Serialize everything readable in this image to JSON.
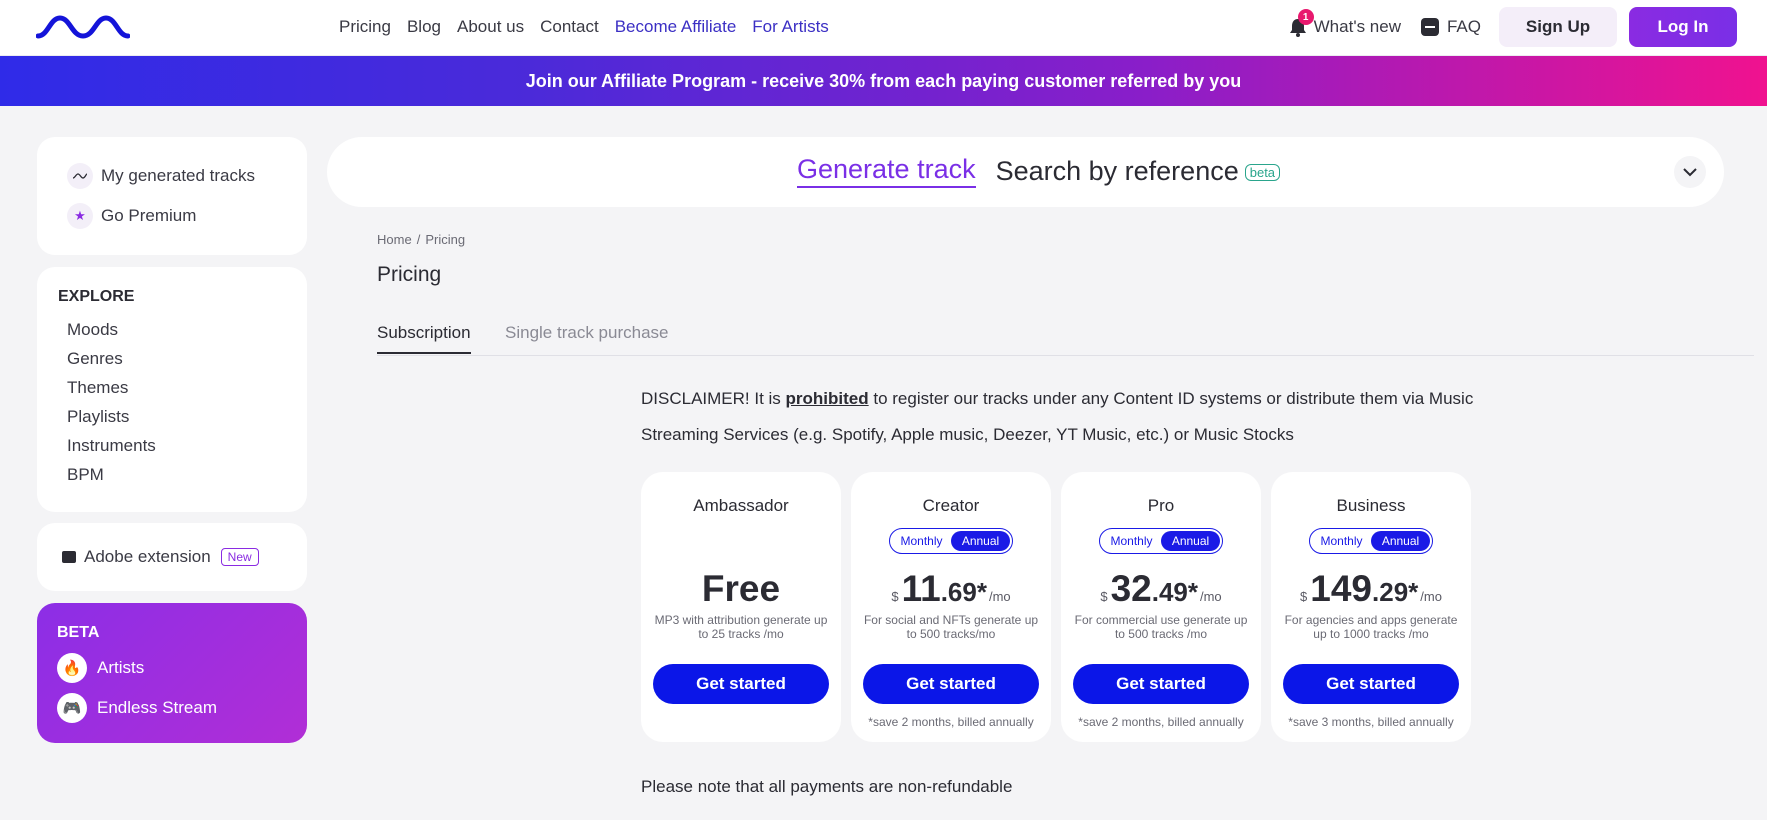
{
  "header": {
    "nav": [
      "Pricing",
      "Blog",
      "About us",
      "Contact",
      "Become Affiliate",
      "For Artists"
    ],
    "whats_new": "What's new",
    "notification_count": "1",
    "faq": "FAQ",
    "sign_up": "Sign Up",
    "log_in": "Log In"
  },
  "banner": "Join our Affiliate Program - receive 30% from each paying customer referred by you",
  "sidebar": {
    "top_items": [
      "My generated tracks",
      "Go Premium"
    ],
    "explore_title": "EXPLORE",
    "explore_items": [
      "Moods",
      "Genres",
      "Themes",
      "Playlists",
      "Instruments",
      "BPM"
    ],
    "adobe": "Adobe extension",
    "adobe_badge": "New",
    "beta_title": "BETA",
    "beta_items": [
      "Artists",
      "Endless Stream"
    ]
  },
  "generator": {
    "active_tab": "Generate track",
    "other_tab": "Search by reference",
    "beta_badge": "beta"
  },
  "breadcrumb": [
    "Home",
    "Pricing"
  ],
  "breadcrumb_sep": "/",
  "page_title": "Pricing",
  "tabs": [
    "Subscription",
    "Single track purchase"
  ],
  "disclaimer": {
    "lead": "DISCLAIMER! It is ",
    "emphasis": "prohibited",
    "rest": " to register our tracks under any Content ID systems or distribute them via Music Streaming Services (e.g. Spotify, Apple music, Deezer, YT Music, etc.) or Music Stocks"
  },
  "plans": [
    {
      "name": "Ambassador",
      "price": "Free",
      "desc": "MP3 with attribution generate up to 25 tracks /mo",
      "cta": "Get started"
    },
    {
      "name": "Creator",
      "toggle": [
        "Monthly",
        "Annual"
      ],
      "currency": "$",
      "int": "11",
      "dec": ".69*",
      "per": "/mo",
      "desc": "For social and NFTs generate up to 500 tracks/mo",
      "cta": "Get started",
      "note": "*save 2 months, billed annually"
    },
    {
      "name": "Pro",
      "toggle": [
        "Monthly",
        "Annual"
      ],
      "currency": "$",
      "int": "32",
      "dec": ".49*",
      "per": "/mo",
      "desc": "For commercial use generate up to 500 tracks /mo",
      "cta": "Get started",
      "note": "*save 2 months, billed annually"
    },
    {
      "name": "Business",
      "toggle": [
        "Monthly",
        "Annual"
      ],
      "currency": "$",
      "int": "149",
      "dec": ".29*",
      "per": "/mo",
      "desc": "For agencies and apps generate up to 1000 tracks /mo",
      "cta": "Get started",
      "note": "*save 3 months, billed annually"
    }
  ],
  "refund_note": "Please note that all payments are non-refundable",
  "colors": {
    "accent": "#7a2fe6",
    "button_blue": "#0b16e8",
    "nav_accent": "#3b2fc4",
    "badge_pink": "#e8186e"
  }
}
